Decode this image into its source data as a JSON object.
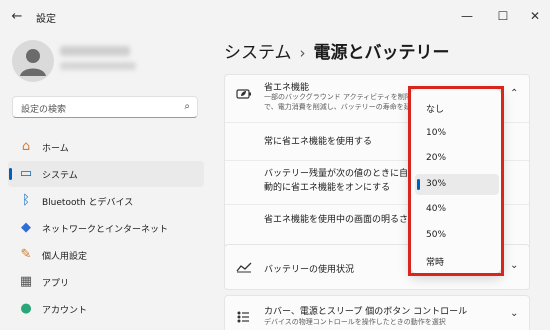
{
  "app": {
    "title": "設定",
    "back_glyph": "←",
    "min_glyph": "—",
    "max_glyph": "☐",
    "close_glyph": "✕"
  },
  "search": {
    "placeholder": "設定の検索",
    "icon": "⌕"
  },
  "sidebar": {
    "items": [
      {
        "label": "ホーム",
        "icon": "home-icon",
        "glyph": "⌂",
        "color": "#d97a2a"
      },
      {
        "label": "システム",
        "icon": "display-icon",
        "glyph": "▭",
        "color": "#0067c0",
        "active": true
      },
      {
        "label": "Bluetooth とデバイス",
        "icon": "bluetooth-icon",
        "glyph": "ᛒ",
        "color": "#0067c0"
      },
      {
        "label": "ネットワークとインターネット",
        "icon": "network-icon",
        "glyph": "◆",
        "color": "#2f6fd8"
      },
      {
        "label": "個人用設定",
        "icon": "brush-icon",
        "glyph": "✎",
        "color": "#c77b30"
      },
      {
        "label": "アプリ",
        "icon": "apps-icon",
        "glyph": "▦",
        "color": "#555555"
      },
      {
        "label": "アカウント",
        "icon": "account-icon",
        "glyph": "●",
        "color": "#2aa67a"
      }
    ]
  },
  "header": {
    "parent": "システム",
    "separator": "›",
    "current": "電源とバッテリー"
  },
  "energy_saver": {
    "title": "省エネ機能",
    "desc_line1": "一部のバックグラウンド アクティビティを制限す",
    "desc_line2": "で、電力消費を削減し、バッテリーの寿命を延",
    "chevron": "⌃",
    "rows": [
      {
        "label": "常に省エネ機能を使用する"
      },
      {
        "label_line1": "バッテリー残量が次の値のときに自",
        "label_line2": "動的に省エネ機能をオンにする"
      },
      {
        "label": "省エネ機能を使用中の画面の明るさを"
      }
    ]
  },
  "battery_usage": {
    "title": "バッテリーの使用状況",
    "chevron": "⌄"
  },
  "lid_buttons": {
    "title": "カバー、電源とスリープ 個のボタン コントロール",
    "desc": "デバイスの物理コントロールを操作したときの動作を選択",
    "chevron": "⌄"
  },
  "dropdown": {
    "options": [
      "なし",
      "10%",
      "20%",
      "30%",
      "40%",
      "50%",
      "常時"
    ],
    "selected_index": 3,
    "highlight_color": "#d9261c"
  }
}
